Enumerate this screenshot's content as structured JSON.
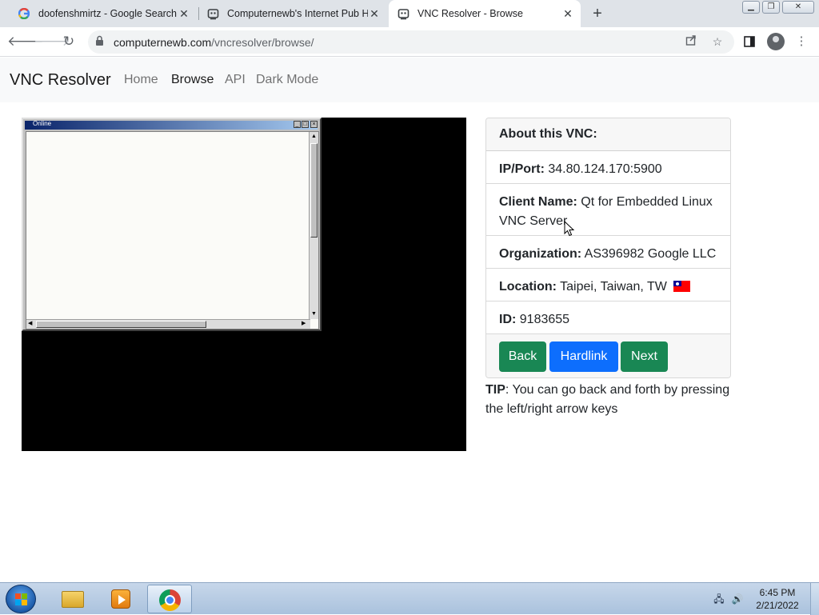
{
  "browser": {
    "tabs": [
      {
        "title": "doofenshmirtz - Google Search",
        "icon": "google-icon"
      },
      {
        "title": "Computernewb's Internet Pub Hu",
        "icon": "computernewb-icon"
      },
      {
        "title": "VNC Resolver - Browse",
        "icon": "computernewb-icon",
        "active": true
      }
    ],
    "url_domain": "computernewb.com",
    "url_path": "/vncresolver/browse/"
  },
  "navbar": {
    "brand": "VNC Resolver",
    "links": [
      "Home",
      "Browse",
      "API",
      "Dark Mode"
    ],
    "active_link": "Browse"
  },
  "vnc_screen": {
    "window_title": "Online"
  },
  "card": {
    "header": "About this VNC:",
    "ip_label": "IP/Port:",
    "ip_value": "34.80.124.170:5900",
    "client_label": "Client Name:",
    "client_value_line1": "Qt for Embedded Linux",
    "client_value_line2": "VNC Server",
    "org_label": "Organization:",
    "org_value": "AS396982 Google LLC",
    "location_label": "Location:",
    "location_value": "Taipei, Taiwan, TW",
    "location_flag": "taiwan-flag",
    "id_label": "ID:",
    "id_value": "9183655",
    "buttons": {
      "back": "Back",
      "hardlink": "Hardlink",
      "next": "Next"
    },
    "colors": {
      "back": "#198754",
      "hardlink": "#0d6efd",
      "next": "#198754"
    }
  },
  "tip": {
    "label": "TIP",
    "text": ": You can go back and forth by pressing the left/right arrow keys"
  },
  "taskbar": {
    "time": "6:45 PM",
    "date": "2/21/2022",
    "apps": [
      "windows-explorer-icon",
      "media-player-icon",
      "chrome-icon"
    ]
  }
}
